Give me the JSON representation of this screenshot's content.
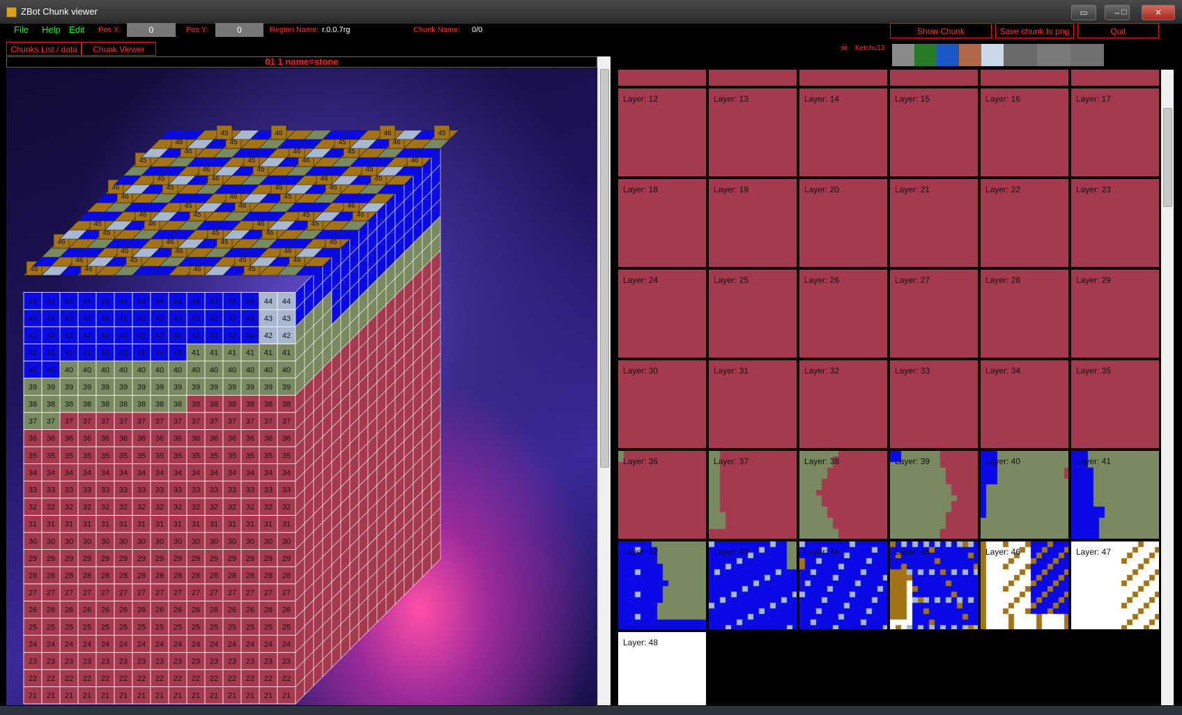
{
  "window": {
    "title": "ZBot Chunk viewer"
  },
  "menu": [
    "File",
    "Help",
    "Edit"
  ],
  "pos_x": {
    "label": "Pos X:",
    "value": "0"
  },
  "pos_y": {
    "label": "Pos Y:",
    "value": "0"
  },
  "region": {
    "label": "Region Name:",
    "value": "r.0.0.7rg"
  },
  "chunk": {
    "label": "Chunk Name:",
    "value": "0/0"
  },
  "buttons": {
    "show": "Show Chunk",
    "save": "Save chunk  to  png",
    "quit": "Quit"
  },
  "tabs": [
    "Chunks List / data",
    "Chunk Viewer"
  ],
  "viewer": {
    "header": "01 1 name=stone"
  },
  "author": "Ketchu13",
  "swatch_colors": [
    "#8a8a8a",
    "#2a7a2a",
    "#1a5ac8",
    "#b06a4a",
    "#c8d8e8",
    "#6a6a6a",
    "#7a7a7a",
    "#707070"
  ],
  "colors": {
    "stone": "#a53a4e",
    "dirt": "#7a8a60",
    "water": "#0a0ae6",
    "wood": "#a47414",
    "ice": "#a8b8d0",
    "air": "#ffffff"
  },
  "layers": [
    {
      "label": "Layer: 12",
      "kind": "stone"
    },
    {
      "label": "Layer: 13",
      "kind": "stone"
    },
    {
      "label": "Layer: 14",
      "kind": "stone"
    },
    {
      "label": "Layer: 15",
      "kind": "stone"
    },
    {
      "label": "Layer: 16",
      "kind": "stone"
    },
    {
      "label": "Layer: 17",
      "kind": "stone"
    },
    {
      "label": "Layer: 18",
      "kind": "stone"
    },
    {
      "label": "Layer: 19",
      "kind": "stone"
    },
    {
      "label": "Layer: 20",
      "kind": "stone"
    },
    {
      "label": "Layer: 21",
      "kind": "stone"
    },
    {
      "label": "Layer: 22",
      "kind": "stone"
    },
    {
      "label": "Layer: 23",
      "kind": "stone"
    },
    {
      "label": "Layer: 24",
      "kind": "stone"
    },
    {
      "label": "Layer: 25",
      "kind": "stone"
    },
    {
      "label": "Layer: 26",
      "kind": "stone"
    },
    {
      "label": "Layer: 27",
      "kind": "stone"
    },
    {
      "label": "Layer: 28",
      "kind": "stone"
    },
    {
      "label": "Layer: 29",
      "kind": "stone"
    },
    {
      "label": "Layer: 30",
      "kind": "stone"
    },
    {
      "label": "Layer: 31",
      "kind": "stone"
    },
    {
      "label": "Layer: 32",
      "kind": "stone"
    },
    {
      "label": "Layer: 33",
      "kind": "stone"
    },
    {
      "label": "Layer: 34",
      "kind": "stone"
    },
    {
      "label": "Layer: 35",
      "kind": "stone"
    },
    {
      "label": "Layer: 36",
      "kind": "l36"
    },
    {
      "label": "Layer: 37",
      "kind": "l37"
    },
    {
      "label": "Layer: 38",
      "kind": "l38"
    },
    {
      "label": "Layer: 39",
      "kind": "l39"
    },
    {
      "label": "Layer: 40",
      "kind": "l40"
    },
    {
      "label": "Layer: 41",
      "kind": "l41"
    },
    {
      "label": "Layer: 42",
      "kind": "l42"
    },
    {
      "label": "Layer: 43",
      "kind": "l43"
    },
    {
      "label": "Layer: 44",
      "kind": "l44"
    },
    {
      "label": "Layer: 45",
      "kind": "l45"
    },
    {
      "label": "Layer: 46",
      "kind": "l46"
    },
    {
      "label": "Layer: 47",
      "kind": "l47"
    },
    {
      "label": "Layer: 48",
      "kind": "air"
    }
  ]
}
